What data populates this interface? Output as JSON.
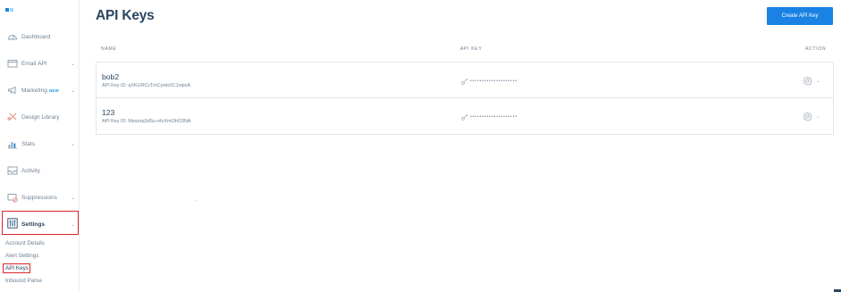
{
  "sidebar": {
    "items": [
      {
        "label": "Dashboard",
        "has_chevron": false
      },
      {
        "label": "Email API",
        "has_chevron": true
      },
      {
        "label": "Marketing",
        "badge": "NEW",
        "has_chevron": true
      },
      {
        "label": "Design Library",
        "has_chevron": false
      },
      {
        "label": "Stats",
        "has_chevron": true
      },
      {
        "label": "Activity",
        "has_chevron": false
      },
      {
        "label": "Suppressions",
        "has_chevron": true
      },
      {
        "label": "Settings",
        "has_chevron": true,
        "active": true
      }
    ],
    "chevron": "⌄",
    "settings_sub": [
      {
        "label": "Account Details"
      },
      {
        "label": "Alert Settings"
      },
      {
        "label": "API Keys",
        "active": true
      },
      {
        "label": "Inbound Parse"
      }
    ]
  },
  "page": {
    "title": "API Keys",
    "create_button": "Create API Key"
  },
  "table": {
    "headers": {
      "name": "NAME",
      "api_key": "API KEY",
      "action": "ACTION"
    },
    "rows": [
      {
        "name": "bob2",
        "id_text": "API Key ID: qXKURCvTmCywbXC1vqioA",
        "key_mask": "••••••••••••••••••••"
      },
      {
        "name": "123",
        "id_text": "API Key ID: Mxszsq3dSu-ofuXmOhO3NA",
        "key_mask": "••••••••••••••••••••"
      }
    ],
    "action_caret": "⌄"
  },
  "colors": {
    "accent": "#1a82e2",
    "text_primary": "#294661",
    "text_secondary": "#6f8193",
    "highlight": "#d9262b",
    "new_badge": "#1a9ce5"
  },
  "icons": {
    "dashboard": "gauge-icon",
    "email_api": "envelope-icon",
    "marketing": "megaphone-icon",
    "design_library": "brush-icon",
    "stats": "bar-chart-icon",
    "activity": "inbox-icon",
    "suppressions": "block-envelope-icon",
    "settings": "sliders-icon",
    "key": "key-icon",
    "gear": "gear-icon"
  }
}
